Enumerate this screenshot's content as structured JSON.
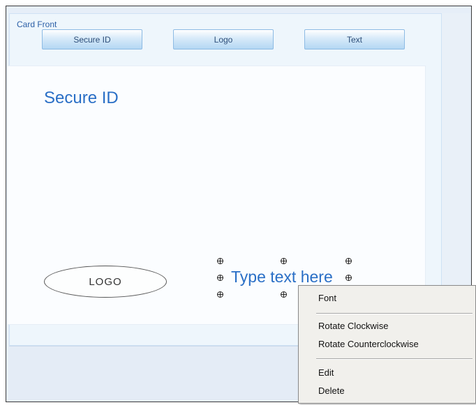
{
  "panel": {
    "title": "Card Front"
  },
  "toolbar": {
    "secure_id_label": "Secure ID",
    "logo_label": "Logo",
    "text_label": "Text"
  },
  "card": {
    "title_text": "Secure ID",
    "logo_placeholder": "LOGO",
    "text_placeholder": "Type text here"
  },
  "context_menu": {
    "items": [
      {
        "label": "Font"
      },
      {
        "label": "Rotate Clockwise"
      },
      {
        "label": "Rotate Counterclockwise"
      },
      {
        "label": "Edit"
      },
      {
        "label": "Delete"
      }
    ]
  },
  "colors": {
    "accent_text": "#2a6fc6",
    "panel_title": "#2b5fa6",
    "button_border": "#8dbbe4"
  }
}
